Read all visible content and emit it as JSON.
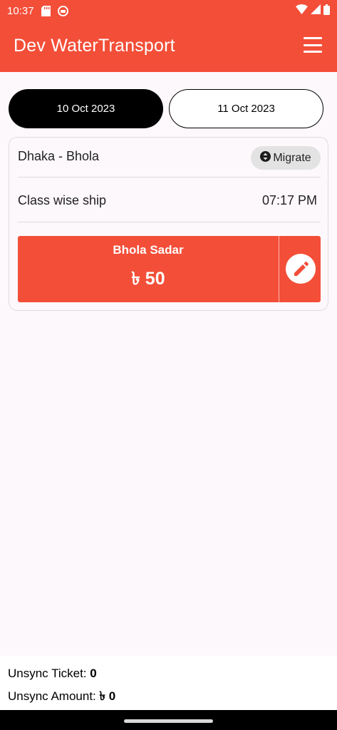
{
  "status_bar": {
    "time": "10:37",
    "left_icons": [
      "sd-card-icon",
      "app-notification-icon"
    ],
    "right_icons": [
      "wifi-icon",
      "signal-icon",
      "battery-icon"
    ]
  },
  "app_bar": {
    "title": "Dev WaterTransport",
    "menu_icon": "hamburger-menu-icon",
    "background": "#f34e38"
  },
  "date_tabs": [
    {
      "label": "10 Oct 2023",
      "selected": true
    },
    {
      "label": "11 Oct 2023",
      "selected": false
    }
  ],
  "trip": {
    "route": "Dhaka - Bhola",
    "migrate_label": "Migrate",
    "ship_class": "Class wise ship",
    "departure_time": "07:17 PM",
    "fare": {
      "stop": "Bhola Sadar",
      "amount": "৳ 50",
      "edit_icon": "edit-pencil-icon"
    }
  },
  "footer": {
    "unsync_ticket_label": "Unsync Ticket:",
    "unsync_ticket_value": "0",
    "unsync_amount_label": "Unsync Amount:",
    "unsync_amount_value": "৳ 0"
  },
  "colors": {
    "accent": "#f34e38",
    "surface": "#fdf8fc",
    "dark": "#000000"
  }
}
